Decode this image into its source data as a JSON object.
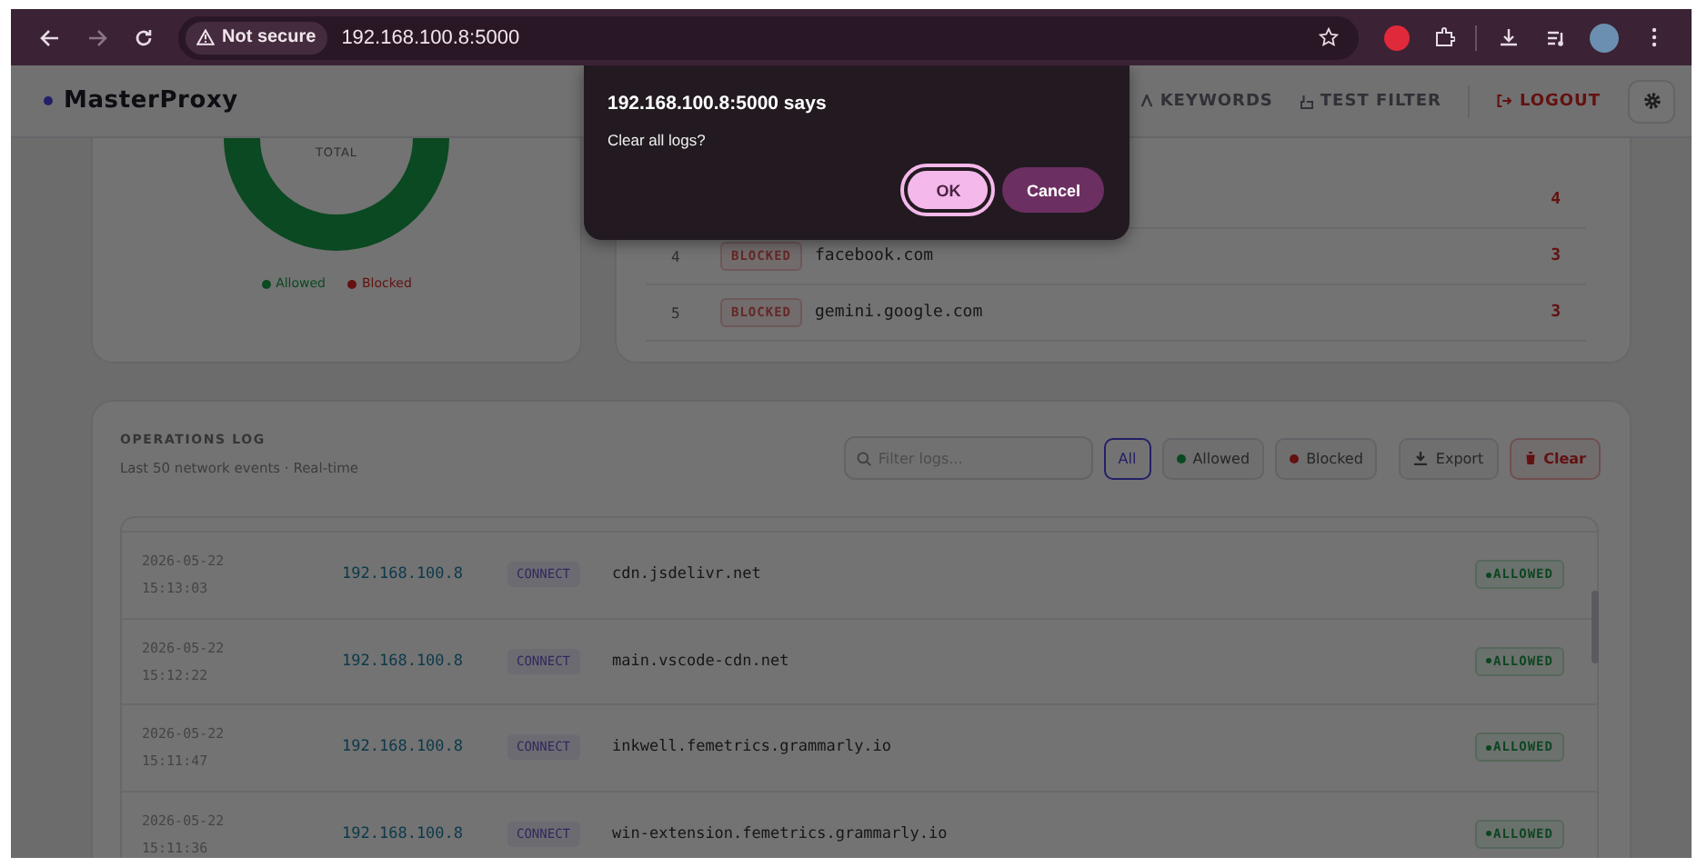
{
  "browser": {
    "security_label": "Not secure",
    "url": "192.168.100.8:5000"
  },
  "header": {
    "logo": "MasterProxy",
    "nav": [
      {
        "label": "KEYWORDS",
        "kind": "keywords"
      },
      {
        "label": "TEST FILTER",
        "kind": "test"
      },
      {
        "label": "LOGOUT",
        "kind": "logout"
      }
    ]
  },
  "traffic_card": {
    "center_label": "TOTAL",
    "legend": [
      {
        "label": "Allowed",
        "color": "#0a4921"
      },
      {
        "label": "Blocked",
        "color": "#631111"
      }
    ]
  },
  "top_domains": {
    "rows": [
      {
        "count": "4"
      },
      {
        "rank": "4",
        "status": "BLOCKED",
        "domain": "facebook.com",
        "count": "3"
      },
      {
        "rank": "5",
        "status": "BLOCKED",
        "domain": "gemini.google.com",
        "count": "3"
      }
    ]
  },
  "operations_log": {
    "title": "OPERATIONS LOG",
    "subtitle": "Last 50 network events · Real-time",
    "search": {
      "placeholder": "Filter logs..."
    },
    "filters": [
      {
        "label": "All",
        "kind": "all",
        "selected": true
      },
      {
        "label": "Allowed",
        "kind": "allowed",
        "selected": false
      },
      {
        "label": "Blocked",
        "kind": "blocked",
        "selected": false
      }
    ],
    "actions": [
      {
        "label": "Export",
        "kind": "export"
      },
      {
        "label": "Clear",
        "kind": "clear"
      }
    ],
    "rows": [
      {
        "date": "2026-05-22",
        "time": "15:13:03",
        "ip": "192.168.100.8",
        "method": "CONNECT",
        "domain": "cdn.jsdelivr.net",
        "status": "ALLOWED"
      },
      {
        "date": "2026-05-22",
        "time": "15:12:22",
        "ip": "192.168.100.8",
        "method": "CONNECT",
        "domain": "main.vscode-cdn.net",
        "status": "ALLOWED"
      },
      {
        "date": "2026-05-22",
        "time": "15:11:47",
        "ip": "192.168.100.8",
        "method": "CONNECT",
        "domain": "inkwell.femetrics.grammarly.io",
        "status": "ALLOWED"
      },
      {
        "date": "2026-05-22",
        "time": "15:11:36",
        "ip": "192.168.100.8",
        "method": "CONNECT",
        "domain": "win-extension.femetrics.grammarly.io",
        "status": "ALLOWED"
      }
    ]
  },
  "dialog": {
    "title": "192.168.100.8:5000 says",
    "message": "Clear all logs?",
    "buttons": [
      {
        "label": "OK",
        "kind": "primary"
      },
      {
        "label": "Cancel",
        "kind": "secondary"
      }
    ]
  }
}
